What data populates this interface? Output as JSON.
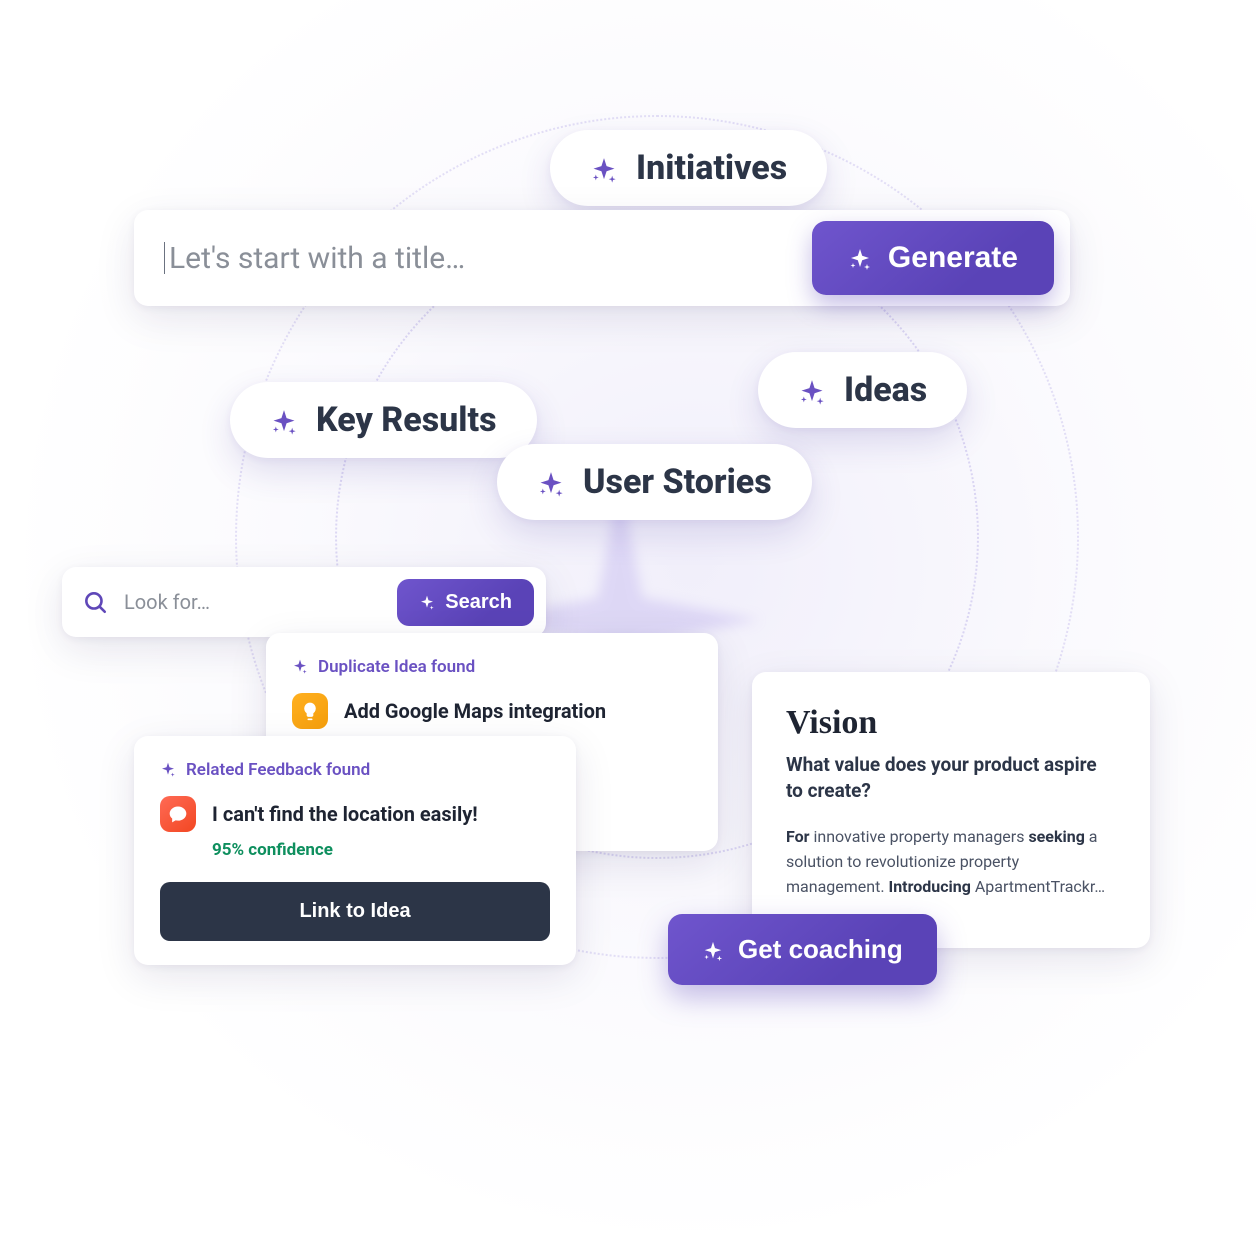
{
  "pills": {
    "initiatives": "Initiatives",
    "key_results": "Key Results",
    "user_stories": "User Stories",
    "ideas": "Ideas"
  },
  "title_bar": {
    "placeholder": "Let's start with a title…",
    "generate_label": "Generate"
  },
  "search": {
    "placeholder": "Look for…",
    "button_label": "Search"
  },
  "duplicate_card": {
    "header": "Duplicate Idea found",
    "item_title": "Add Google Maps integration"
  },
  "related_card": {
    "header": "Related Feedback found",
    "item_title": "I can't find the location easily!",
    "confidence": "95% confidence",
    "button_label": "Link to Idea"
  },
  "vision": {
    "title": "Vision",
    "subtitle": "What value does your product aspire to create?",
    "b1": "For",
    "t1": " innovative property managers ",
    "b2": "seeking",
    "t2": " a solution to revolutionize property management. ",
    "b3": "Introducing",
    "t3": " ApartmentTrackr…"
  },
  "coaching": {
    "label": "Get coaching"
  }
}
